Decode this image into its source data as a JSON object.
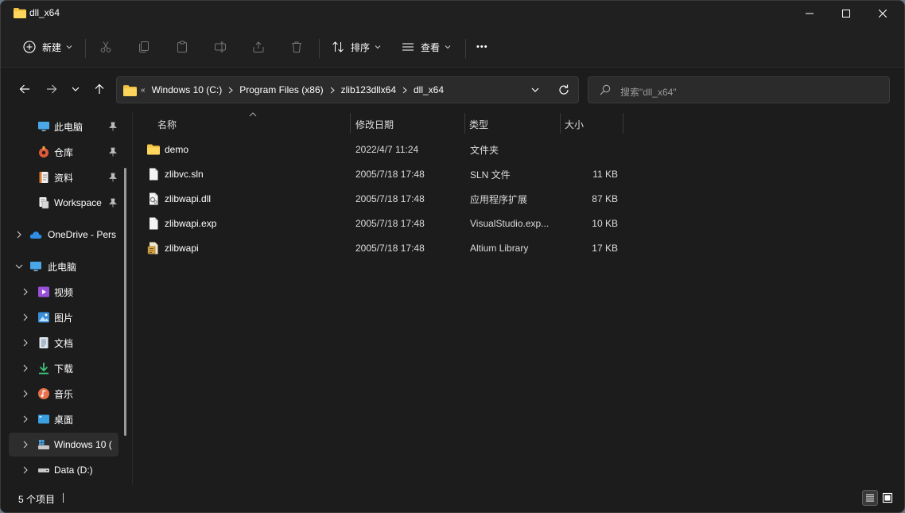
{
  "window": {
    "title": "dll_x64"
  },
  "toolbar": {
    "new_label": "新建",
    "sort_label": "排序",
    "view_label": "查看",
    "more_label": "•••"
  },
  "address": {
    "lead": "«",
    "crumbs": [
      "Windows 10 (C:)",
      "Program Files (x86)",
      "zlib123dllx64",
      "dll_x64"
    ]
  },
  "search": {
    "placeholder": "搜索\"dll_x64\""
  },
  "sidebar": {
    "quick": [
      {
        "label": "此电脑",
        "icon": "monitor-icon",
        "pinned": true
      },
      {
        "label": "仓库",
        "icon": "repo-icon",
        "pinned": true
      },
      {
        "label": "资料",
        "icon": "notes-icon",
        "pinned": true
      },
      {
        "label": "Workspace",
        "icon": "workspace-icon",
        "pinned": true
      }
    ],
    "onedrive": {
      "label": "OneDrive - Pers"
    },
    "thispc": {
      "label": "此电脑"
    },
    "children": [
      {
        "label": "视频",
        "icon": "video-icon"
      },
      {
        "label": "图片",
        "icon": "pictures-icon"
      },
      {
        "label": "文档",
        "icon": "documents-icon"
      },
      {
        "label": "下载",
        "icon": "download-icon"
      },
      {
        "label": "音乐",
        "icon": "music-icon"
      },
      {
        "label": "桌面",
        "icon": "desktop-icon"
      },
      {
        "label": "Windows 10 (",
        "icon": "drive-c-icon"
      },
      {
        "label": "Data (D:)",
        "icon": "drive-icon"
      }
    ]
  },
  "columns": {
    "name": "名称",
    "modified": "修改日期",
    "type": "类型",
    "size": "大小"
  },
  "files": [
    {
      "name": "demo",
      "modified": "2022/4/7 11:24",
      "type": "文件夹",
      "size": "",
      "icon": "folder-icon"
    },
    {
      "name": "zlibvc.sln",
      "modified": "2005/7/18 17:48",
      "type": "SLN 文件",
      "size": "11 KB",
      "icon": "file-icon"
    },
    {
      "name": "zlibwapi.dll",
      "modified": "2005/7/18 17:48",
      "type": "应用程序扩展",
      "size": "87 KB",
      "icon": "dll-icon"
    },
    {
      "name": "zlibwapi.exp",
      "modified": "2005/7/18 17:48",
      "type": "VisualStudio.exp...",
      "size": "10 KB",
      "icon": "file-icon"
    },
    {
      "name": "zlibwapi",
      "modified": "2005/7/18 17:48",
      "type": "Altium Library",
      "size": "17 KB",
      "icon": "library-icon"
    }
  ],
  "status": {
    "count_text": "5 个项目"
  },
  "colors": {
    "folder": "#f5c343",
    "accent": "#4cc2ff",
    "background": "#1c1c1c"
  }
}
